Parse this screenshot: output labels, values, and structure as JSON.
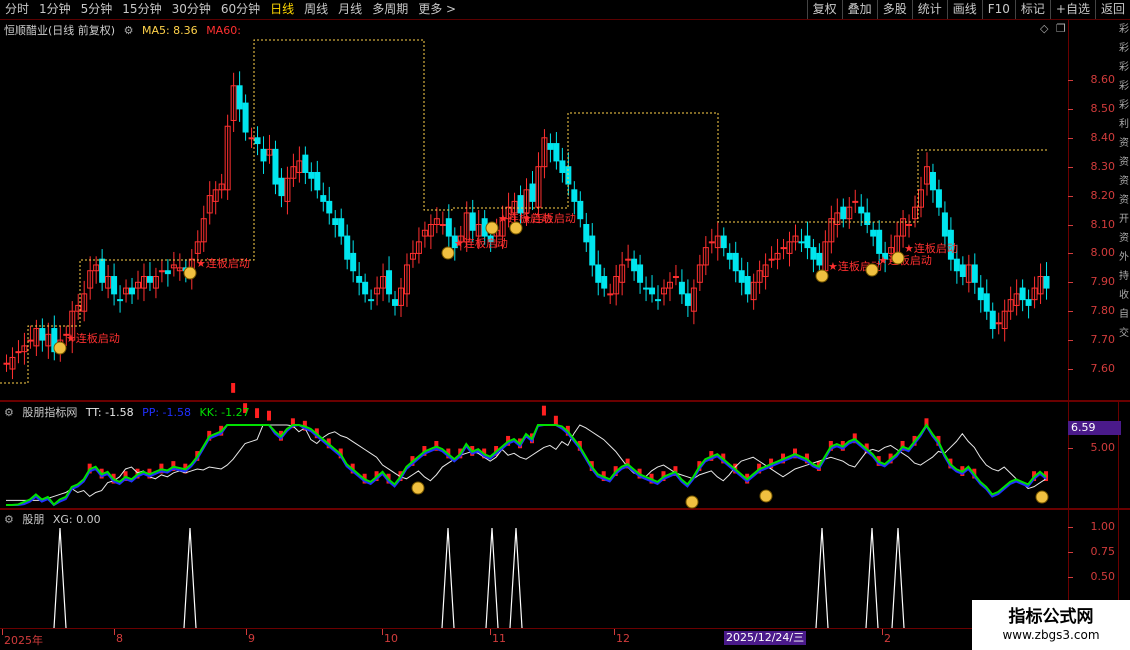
{
  "toolbar": {
    "left": [
      "分时",
      "1分钟",
      "5分钟",
      "15分钟",
      "30分钟",
      "60分钟",
      "日线",
      "周线",
      "月线",
      "多周期",
      "更多 >"
    ],
    "active": "日线",
    "right": [
      "复权",
      "叠加",
      "多股",
      "统计",
      "画线",
      "F10",
      "标记",
      "+自选",
      "返回"
    ]
  },
  "main_panel": {
    "title": "恒顺醋业(日线 前复权)",
    "ma5_label": "MA5: 8.36",
    "ma60_label": "MA60:",
    "signal_label": "连板启动",
    "y_ticks": [
      "8.60",
      "8.50",
      "8.40",
      "8.30",
      "8.20",
      "8.10",
      "8.00",
      "7.90",
      "7.80",
      "7.70",
      "7.60"
    ]
  },
  "indicator_panel": {
    "title": "股朋指标网",
    "tt": "TT: -1.58",
    "pp": "PP: -1.58",
    "kk": "KK: -1.27",
    "badge": "6.59",
    "y_tick": "5.00"
  },
  "xg_panel": {
    "title": "股朋",
    "xg": "XG: 0.00",
    "y_ticks": [
      "1.00",
      "0.75",
      "0.50"
    ]
  },
  "x_axis": {
    "labels": [
      "2025年",
      "8",
      "9",
      "10",
      "11",
      "12",
      "2"
    ],
    "cursor_date": "2025/12/24/三"
  },
  "watermark": {
    "title": "指标公式网",
    "url": "www.zbgs3.com"
  },
  "side_text": [
    "彩",
    "彩",
    "彩",
    "彩",
    "彩",
    "利",
    "资",
    "资",
    "资",
    "资",
    "开",
    "资",
    "外",
    "持",
    "收",
    "自",
    "交"
  ],
  "colors": {
    "up": "#ff3030",
    "down": "#00e5ee",
    "ma5": "#ffd24a",
    "tt": "#2030ff",
    "kk": "#00e000",
    "line": "#e8e8e8"
  }
}
